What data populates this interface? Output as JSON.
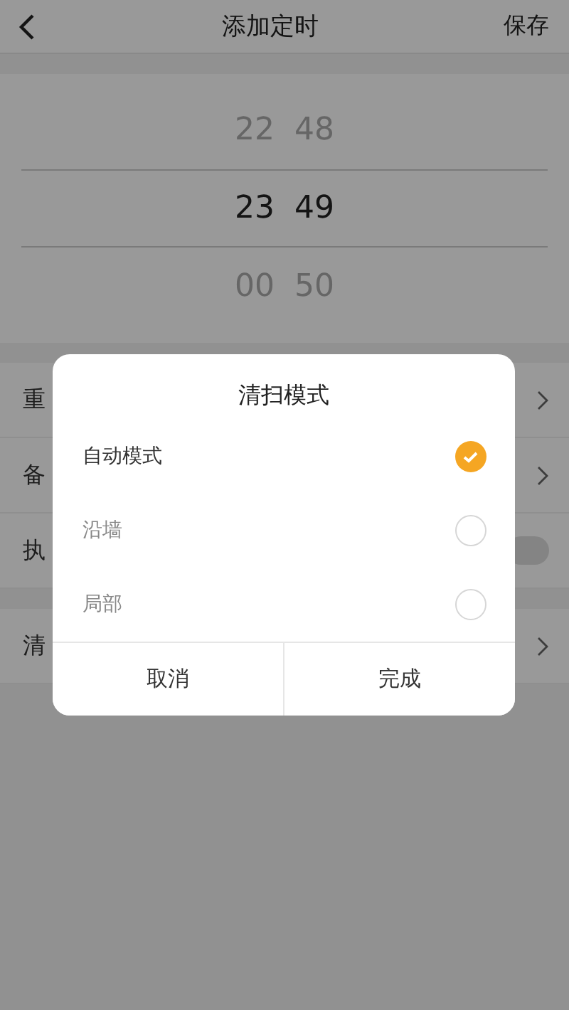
{
  "header": {
    "title": "添加定时",
    "action": "保存"
  },
  "picker": [
    {
      "hour": "22",
      "minute": "48",
      "selected": false
    },
    {
      "hour": "23",
      "minute": "49",
      "selected": true
    },
    {
      "hour": "00",
      "minute": "50",
      "selected": false
    }
  ],
  "setting_groups": [
    [
      {
        "kind": "link",
        "label": "重"
      },
      {
        "kind": "link",
        "label": "备"
      },
      {
        "kind": "toggle",
        "label": "执",
        "on": false
      }
    ],
    [
      {
        "kind": "link",
        "label": "清"
      }
    ]
  ],
  "dialog": {
    "title": "清扫模式",
    "options": [
      {
        "label": "自动模式",
        "selected": true
      },
      {
        "label": "沿墙",
        "selected": false
      },
      {
        "label": "局部",
        "selected": false
      }
    ],
    "buttons": [
      "取消",
      "完成"
    ]
  }
}
